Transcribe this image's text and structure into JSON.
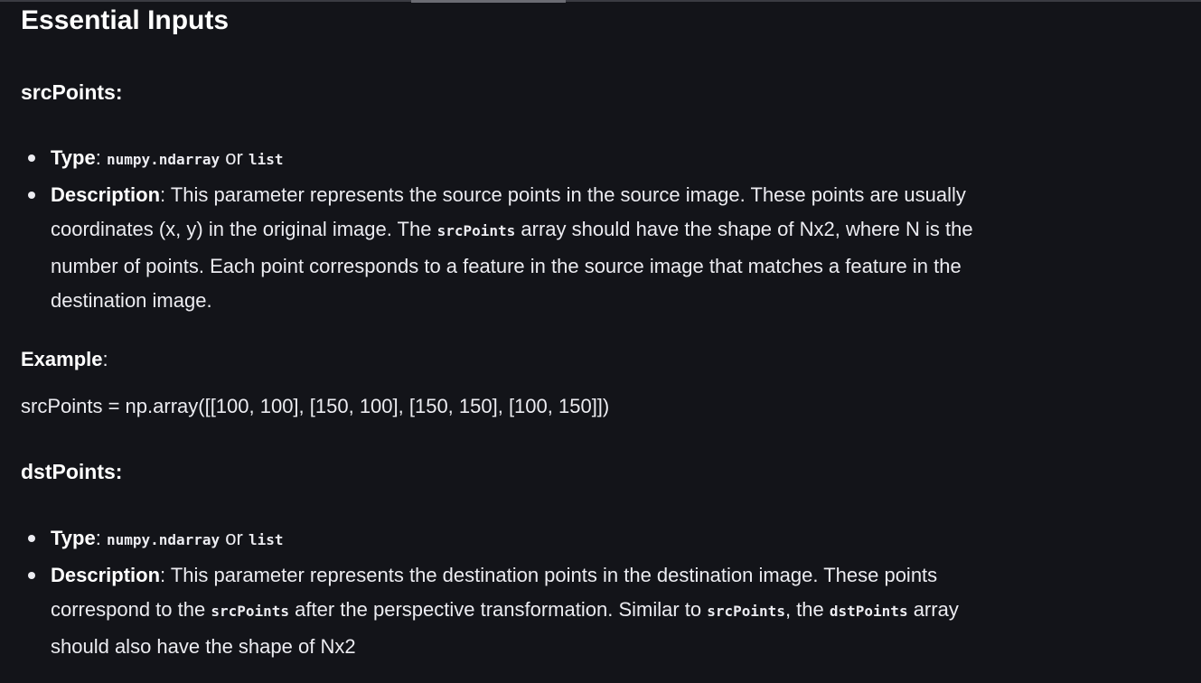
{
  "section_title": "Essential Inputs",
  "src": {
    "heading": "srcPoints:",
    "type_label": "Type",
    "type_colon": ": ",
    "type_code1": "numpy.ndarray",
    "type_or": " or ",
    "type_code2": "list",
    "desc_label": "Description",
    "desc_part1": ": This parameter represents the source points in the source image. These points are usually coordinates (x, y) in the original image. The ",
    "desc_code": "srcPoints",
    "desc_part2": " array should have the shape of Nx2, where N is the number of points. Each point corresponds to a feature in the source image that matches a feature in the destination image.",
    "example_label": "Example",
    "example_colon": ":",
    "example_code": "srcPoints = np.array([[100, 100], [150, 100], [150, 150], [100, 150]])"
  },
  "dst": {
    "heading": "dstPoints:",
    "type_label": "Type",
    "type_colon": ": ",
    "type_code1": "numpy.ndarray",
    "type_or": " or ",
    "type_code2": "list",
    "desc_label": "Description",
    "desc_part1": ": This parameter represents the destination points in the destination image. These points correspond to the ",
    "desc_code1": "srcPoints",
    "desc_part2": " after the perspective transformation. Similar to ",
    "desc_code2": "srcPoints",
    "desc_part3": ", the ",
    "desc_code3": "dstPoints",
    "desc_part4": " array should also have the shape of Nx2"
  }
}
